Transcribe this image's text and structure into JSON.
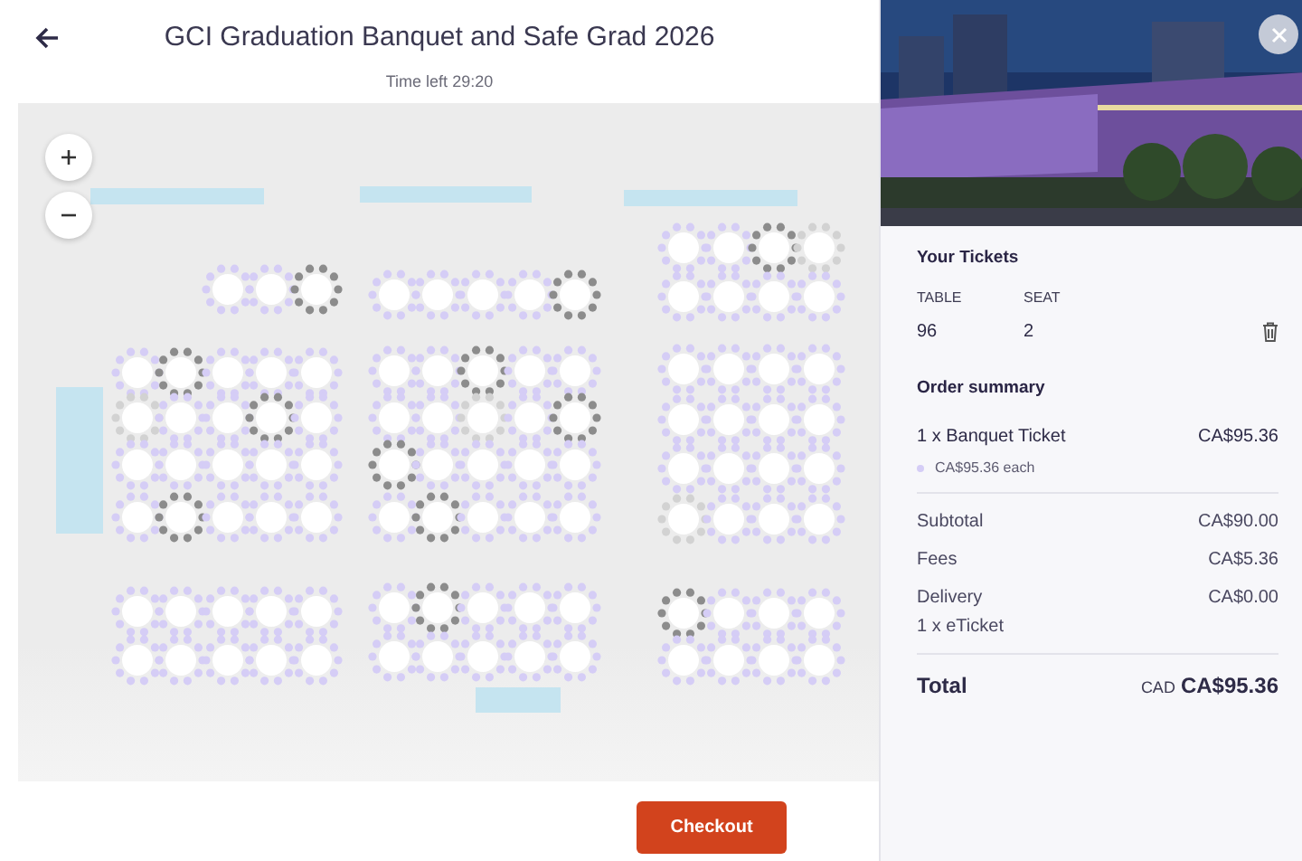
{
  "header": {
    "title": "GCI Graduation Banquet and Safe Grad 2026",
    "timer": "Time left 29:20"
  },
  "map": {
    "blocks": [
      {
        "rows": [
          {
            "tables": [
              {
                "sold": false,
                "partial": false
              },
              {
                "sold": false,
                "partial": false
              },
              {
                "sold": true,
                "partial": false
              }
            ]
          },
          {
            "tables": [
              {
                "sold": false,
                "partial": false
              },
              {
                "sold": true,
                "partial": false
              },
              {
                "sold": false,
                "partial": false
              },
              {
                "sold": false,
                "partial": false
              },
              {
                "sold": false,
                "partial": false
              }
            ]
          },
          {
            "tables": [
              {
                "sold": false,
                "partial": true
              },
              {
                "sold": false,
                "partial": false
              },
              {
                "sold": false,
                "partial": false
              },
              {
                "sold": true,
                "partial": false
              },
              {
                "sold": false,
                "partial": false
              }
            ]
          },
          {
            "tables": [
              {
                "sold": false,
                "partial": false
              },
              {
                "sold": false,
                "partial": false
              },
              {
                "sold": false,
                "partial": false
              },
              {
                "sold": false,
                "partial": false
              },
              {
                "sold": false,
                "partial": false
              }
            ]
          },
          {
            "tables": [
              {
                "sold": false,
                "partial": false
              },
              {
                "sold": true,
                "partial": false
              },
              {
                "sold": false,
                "partial": false
              },
              {
                "sold": false,
                "partial": false
              },
              {
                "sold": false,
                "partial": false
              }
            ]
          },
          {
            "tables": [
              {
                "sold": false,
                "partial": false
              },
              {
                "sold": false,
                "partial": false
              },
              {
                "sold": false,
                "partial": false
              },
              {
                "sold": false,
                "partial": false
              },
              {
                "sold": false,
                "partial": false
              }
            ]
          },
          {
            "tables": [
              {
                "sold": false,
                "partial": false
              },
              {
                "sold": false,
                "partial": false
              },
              {
                "sold": false,
                "partial": false
              },
              {
                "sold": false,
                "partial": false
              },
              {
                "sold": false,
                "partial": false
              }
            ]
          }
        ]
      },
      {
        "rows": [
          {
            "tables": [
              {
                "sold": false,
                "partial": false
              },
              {
                "sold": false,
                "partial": false
              },
              {
                "sold": false,
                "partial": false
              },
              {
                "sold": false,
                "partial": false
              },
              {
                "sold": true,
                "partial": false
              }
            ]
          },
          {
            "tables": [
              {
                "sold": false,
                "partial": false
              },
              {
                "sold": false,
                "partial": false
              },
              {
                "sold": true,
                "partial": false
              },
              {
                "sold": false,
                "partial": false
              },
              {
                "sold": false,
                "partial": false
              }
            ]
          },
          {
            "tables": [
              {
                "sold": false,
                "partial": false
              },
              {
                "sold": false,
                "partial": false
              },
              {
                "sold": false,
                "partial": true
              },
              {
                "sold": false,
                "partial": false
              },
              {
                "sold": true,
                "partial": false
              }
            ]
          },
          {
            "tables": [
              {
                "sold": true,
                "partial": false
              },
              {
                "sold": false,
                "partial": false
              },
              {
                "sold": false,
                "partial": false
              },
              {
                "sold": false,
                "partial": false
              },
              {
                "sold": false,
                "partial": false
              }
            ]
          },
          {
            "tables": [
              {
                "sold": false,
                "partial": false
              },
              {
                "sold": true,
                "partial": false
              },
              {
                "sold": false,
                "partial": false
              },
              {
                "sold": false,
                "partial": false
              },
              {
                "sold": false,
                "partial": false
              }
            ]
          },
          {
            "tables": [
              {
                "sold": false,
                "partial": false
              },
              {
                "sold": true,
                "partial": false
              },
              {
                "sold": false,
                "partial": false
              },
              {
                "sold": false,
                "partial": false
              },
              {
                "sold": false,
                "partial": false
              }
            ]
          },
          {
            "tables": [
              {
                "sold": false,
                "partial": false
              },
              {
                "sold": false,
                "partial": false
              },
              {
                "sold": false,
                "partial": false
              },
              {
                "sold": false,
                "partial": false
              },
              {
                "sold": false,
                "partial": false
              }
            ]
          }
        ]
      },
      {
        "rows": [
          {
            "tables": [
              {
                "sold": false,
                "partial": false
              },
              {
                "sold": false,
                "partial": false
              },
              {
                "sold": true,
                "partial": false
              },
              {
                "sold": false,
                "partial": true
              }
            ]
          },
          {
            "tables": [
              {
                "sold": false,
                "partial": false
              },
              {
                "sold": false,
                "partial": false
              },
              {
                "sold": false,
                "partial": false
              },
              {
                "sold": false,
                "partial": false
              }
            ]
          },
          {
            "tables": [
              {
                "sold": false,
                "partial": false
              },
              {
                "sold": false,
                "partial": false
              },
              {
                "sold": false,
                "partial": false
              },
              {
                "sold": false,
                "partial": false
              }
            ]
          },
          {
            "tables": [
              {
                "sold": false,
                "partial": false
              },
              {
                "sold": false,
                "partial": false
              },
              {
                "sold": false,
                "partial": false
              },
              {
                "sold": false,
                "partial": false
              }
            ]
          },
          {
            "tables": [
              {
                "sold": false,
                "partial": false
              },
              {
                "sold": false,
                "partial": false
              },
              {
                "sold": false,
                "partial": false
              },
              {
                "sold": false,
                "partial": false
              }
            ]
          },
          {
            "tables": [
              {
                "sold": false,
                "partial": true
              },
              {
                "sold": false,
                "partial": false
              },
              {
                "sold": false,
                "partial": false
              },
              {
                "sold": false,
                "partial": false
              }
            ]
          },
          {
            "tables": [
              {
                "sold": true,
                "partial": false
              },
              {
                "sold": false,
                "partial": false
              },
              {
                "sold": false,
                "partial": false
              },
              {
                "sold": false,
                "partial": false
              }
            ]
          },
          {
            "tables": [
              {
                "sold": false,
                "partial": false
              },
              {
                "sold": false,
                "partial": false
              },
              {
                "sold": false,
                "partial": false
              },
              {
                "sold": false,
                "partial": false
              }
            ]
          }
        ]
      }
    ]
  },
  "tickets": {
    "heading": "Your Tickets",
    "columns": [
      "TABLE",
      "SEAT"
    ],
    "items": [
      {
        "table": "96",
        "seat": "2"
      }
    ]
  },
  "summary": {
    "heading": "Order summary",
    "items": [
      {
        "label": "1 x Banquet Ticket",
        "amount": "CA$95.36",
        "note": "CA$95.36 each"
      }
    ],
    "lines": [
      {
        "label": "Subtotal",
        "amount": "CA$90.00"
      },
      {
        "label": "Fees",
        "amount": "CA$5.36"
      },
      {
        "label": "Delivery",
        "amount": "CA$0.00",
        "note": "1 x eTicket"
      }
    ],
    "total": {
      "label": "Total",
      "currency": "CAD",
      "amount": "CA$95.36"
    }
  },
  "checkout": "Checkout"
}
